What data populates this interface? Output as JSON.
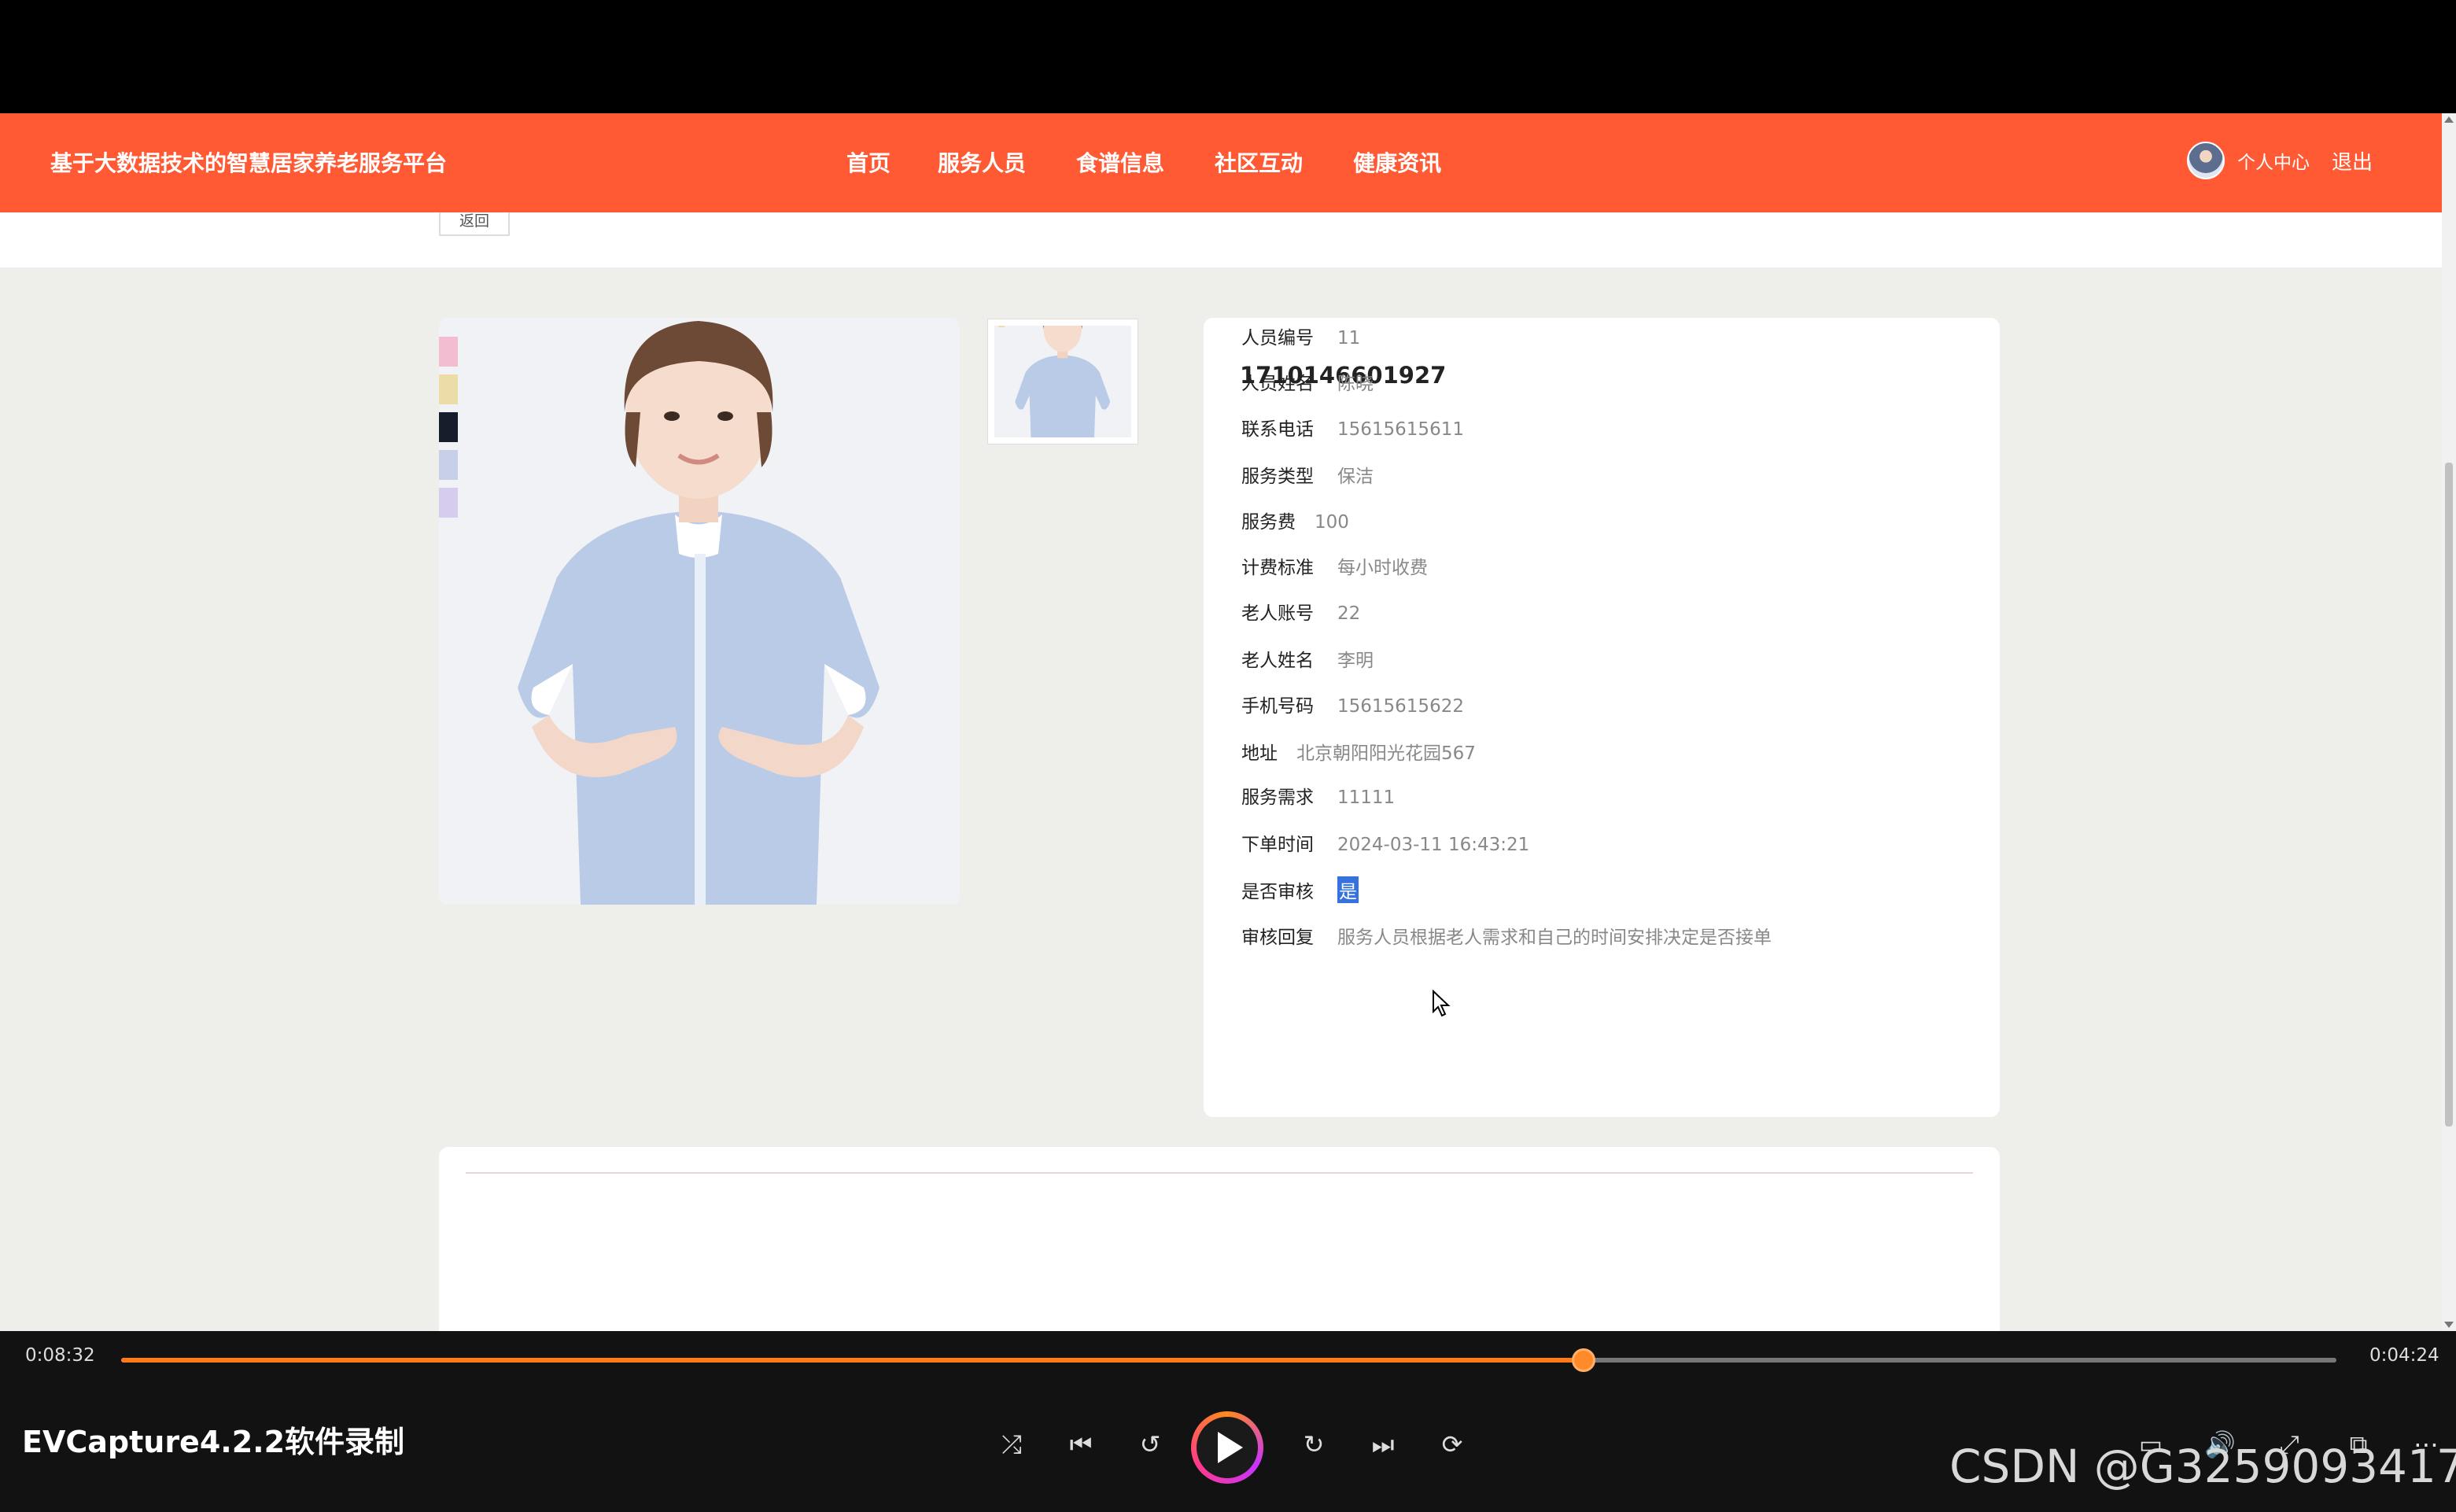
{
  "site_title": "基于大数据技术的智慧居家养老服务平台",
  "nav": [
    "首页",
    "服务人员",
    "食谱信息",
    "社区互动",
    "健康资讯"
  ],
  "user": {
    "center": "个人中心",
    "logout": "退出"
  },
  "back_label": "返回",
  "swatch_colors": [
    "#f2bdd0",
    "#ecdca8",
    "#161d2b",
    "#c8cfe8",
    "#d5ccee"
  ],
  "detail": {
    "order_no": "1710146601927",
    "rows": [
      {
        "label": "人员编号",
        "value": "11"
      },
      {
        "label": "人员姓名",
        "value": "陈晓"
      },
      {
        "label": "联系电话",
        "value": "15615615611"
      },
      {
        "label": "服务类型",
        "value": "保洁"
      },
      {
        "label": "服务费",
        "value": "100"
      },
      {
        "label": "计费标准",
        "value": "每小时收费"
      },
      {
        "label": "老人账号",
        "value": "22"
      },
      {
        "label": "老人姓名",
        "value": "李明"
      },
      {
        "label": "手机号码",
        "value": "15615615622"
      },
      {
        "label": "地址",
        "value": "北京朝阳阳光花园567"
      },
      {
        "label": "服务需求",
        "value": "11111"
      },
      {
        "label": "下单时间",
        "value": "2024-03-11 16:43:21"
      },
      {
        "label": "是否审核",
        "value": "是"
      },
      {
        "label": "审核回复",
        "value": "服务人员根据老人需求和自己的时间安排决定是否接单"
      }
    ]
  },
  "player": {
    "elapsed": "0:08:32",
    "remaining": "0:04:24",
    "progress": 0.66,
    "recorder_name": "EVCapture4.2.2软件录制",
    "accent": "#ff7a1a"
  },
  "watermark": "CSDN @G3259093417"
}
